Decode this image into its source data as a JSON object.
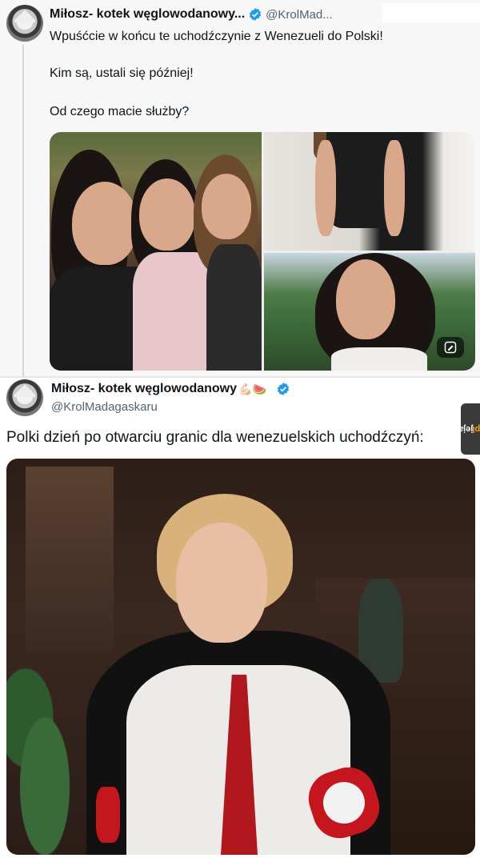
{
  "tweet1": {
    "author_name": "Miłosz- kotek węglowodanowy...",
    "author_handle": "@KrolMad...",
    "lines": [
      "Wpuśćcie w końcu te uchodźczynie z Wenezueli do Polski!",
      "Kim są, ustali się później!",
      "Od czego macie służby?"
    ],
    "alt_badge_icon": "alt-text-icon"
  },
  "tweet2": {
    "author_name": "Miłosz- kotek węglowodanowy",
    "emoji": "💪🏻🍉",
    "author_handle": "@KrolMadagaskaru",
    "text": "Polki dzień po otwarciu granic dla wenezuelskich uchodźczyń:"
  },
  "watermark": {
    "brand": "jeja",
    "tld": ".pl"
  },
  "colors": {
    "verified": "#1d9bf0",
    "handle": "#536471",
    "text": "#0f1419"
  }
}
